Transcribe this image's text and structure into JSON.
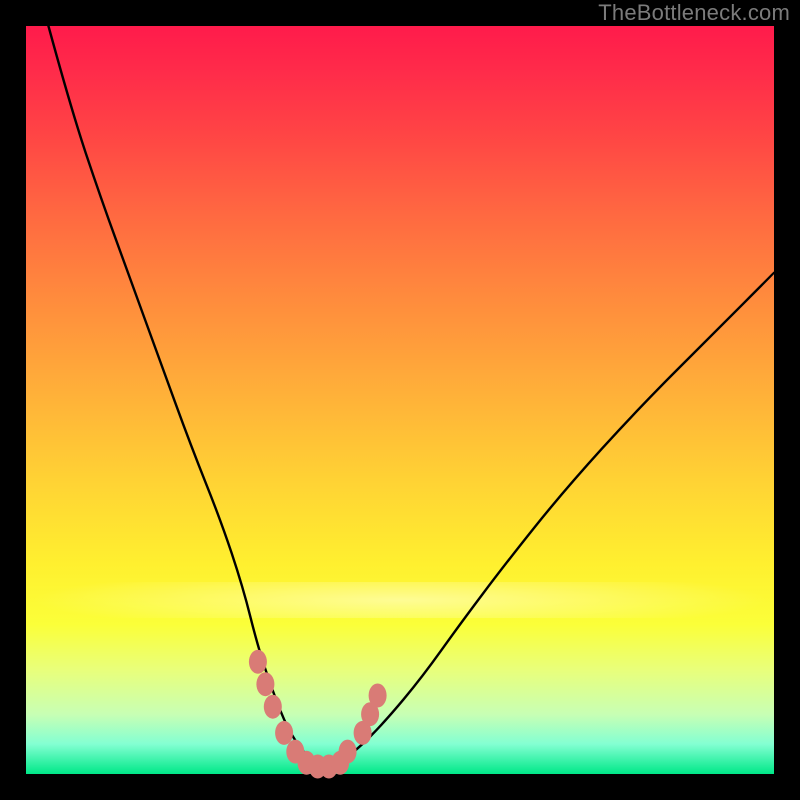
{
  "watermark": "TheBottleneck.com",
  "colors": {
    "frame": "#000000",
    "curve_stroke": "#000000",
    "marker_fill": "#d97b76",
    "gradient_top": "#ff1b4b",
    "gradient_bottom": "#00e888"
  },
  "chart_data": {
    "type": "line",
    "title": "",
    "xlabel": "",
    "ylabel": "",
    "xlim": [
      0,
      100
    ],
    "ylim": [
      0,
      100
    ],
    "note": "No axes, ticks, or numeric labels are rendered in the image; values below are geometric estimates of the drawn curve in a 0–100 normalized space. Y axis inverted visually (0 at top of gradient).",
    "series": [
      {
        "name": "bottleneck-curve",
        "x": [
          3,
          6,
          10,
          14,
          18,
          22,
          26,
          29,
          31,
          33,
          35,
          37,
          39,
          41,
          44,
          48,
          53,
          58,
          64,
          72,
          82,
          92,
          100
        ],
        "y": [
          100,
          89,
          77,
          66,
          55,
          44,
          34,
          25,
          17,
          11,
          6,
          3,
          1,
          1,
          3,
          7,
          13,
          20,
          28,
          38,
          49,
          59,
          67
        ]
      }
    ],
    "markers": [
      {
        "x": 31.0,
        "y": 15.0
      },
      {
        "x": 32.0,
        "y": 12.0
      },
      {
        "x": 33.0,
        "y": 9.0
      },
      {
        "x": 34.5,
        "y": 5.5
      },
      {
        "x": 36.0,
        "y": 3.0
      },
      {
        "x": 37.5,
        "y": 1.5
      },
      {
        "x": 39.0,
        "y": 1.0
      },
      {
        "x": 40.5,
        "y": 1.0
      },
      {
        "x": 42.0,
        "y": 1.5
      },
      {
        "x": 43.0,
        "y": 3.0
      },
      {
        "x": 45.0,
        "y": 5.5
      },
      {
        "x": 46.0,
        "y": 8.0
      },
      {
        "x": 47.0,
        "y": 10.5
      }
    ]
  }
}
